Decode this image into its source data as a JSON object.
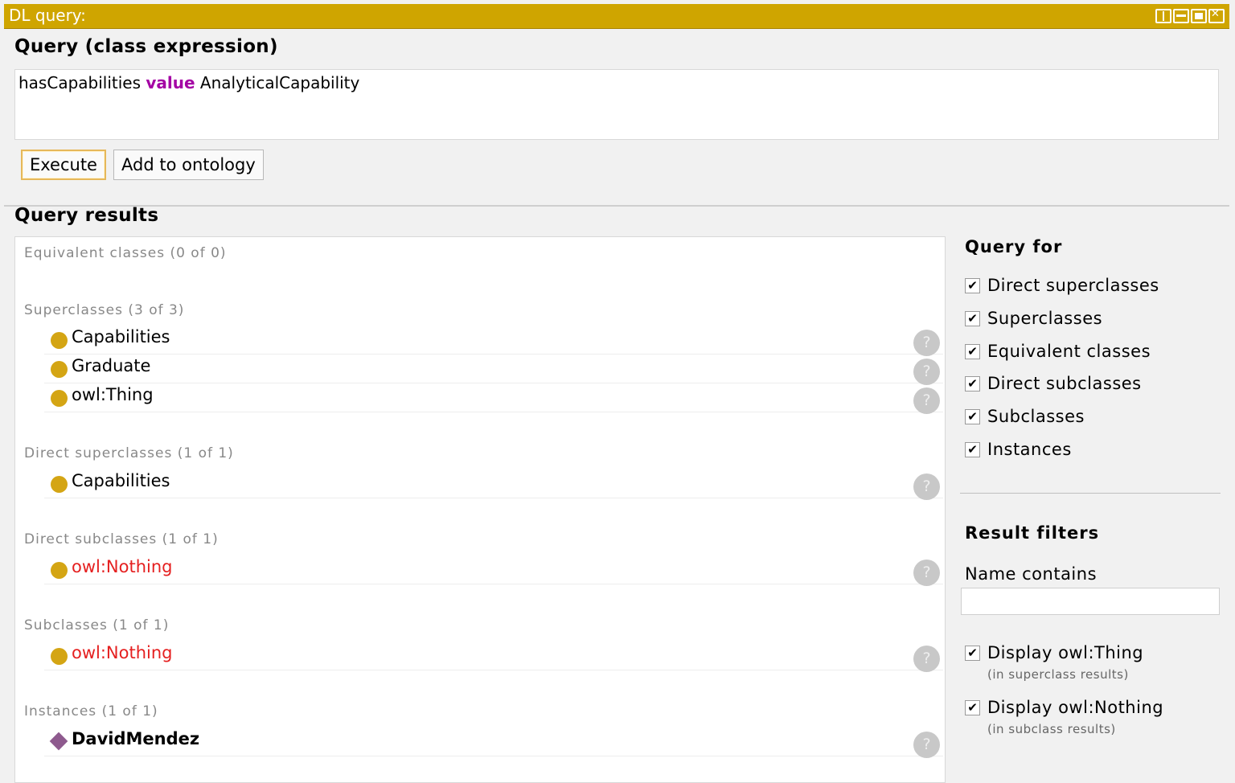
{
  "window": {
    "title": "DL query:"
  },
  "query": {
    "heading": "Query (class expression)",
    "expr_pre": "hasCapabilities ",
    "expr_kw": "value",
    "expr_post": " AnalyticalCapability",
    "execute_label": "Execute",
    "add_label": "Add to ontology"
  },
  "results": {
    "heading": "Query results",
    "sections": [
      {
        "label": "Equivalent classes (0 of 0)",
        "items": []
      },
      {
        "label": "Superclasses (3 of 3)",
        "items": [
          {
            "name": "Capabilities",
            "kind": "class"
          },
          {
            "name": "Graduate",
            "kind": "class"
          },
          {
            "name": "owl:Thing",
            "kind": "class"
          }
        ]
      },
      {
        "label": "Direct superclasses (1 of 1)",
        "items": [
          {
            "name": "Capabilities",
            "kind": "class"
          }
        ]
      },
      {
        "label": "Direct subclasses (1 of 1)",
        "items": [
          {
            "name": "owl:Nothing",
            "kind": "class",
            "color": "#e52020"
          }
        ]
      },
      {
        "label": "Subclasses (1 of 1)",
        "items": [
          {
            "name": "owl:Nothing",
            "kind": "class",
            "color": "#e52020"
          }
        ]
      },
      {
        "label": "Instances (1 of 1)",
        "items": [
          {
            "name": "DavidMendez",
            "kind": "individual"
          }
        ]
      }
    ],
    "help_glyph": "?"
  },
  "query_for": {
    "heading": "Query for",
    "options": [
      {
        "label": "Direct superclasses",
        "checked": true
      },
      {
        "label": "Superclasses",
        "checked": true
      },
      {
        "label": "Equivalent classes",
        "checked": true
      },
      {
        "label": "Direct subclasses",
        "checked": true
      },
      {
        "label": "Subclasses",
        "checked": true
      },
      {
        "label": "Instances",
        "checked": true
      }
    ]
  },
  "filters": {
    "heading": "Result filters",
    "name_contains_label": "Name contains",
    "name_contains_value": "",
    "display_thing": {
      "label": "Display owl:Thing",
      "note": "(in superclass results)",
      "checked": true
    },
    "display_nothing": {
      "label": "Display owl:Nothing",
      "note": "(in subclass results)",
      "checked": true
    }
  },
  "colors": {
    "accent": "#cfa500",
    "class_dot": "#d4a514",
    "individual": "#8e5a8e",
    "keyword": "#a400a4",
    "unsatisfiable": "#e52020"
  }
}
